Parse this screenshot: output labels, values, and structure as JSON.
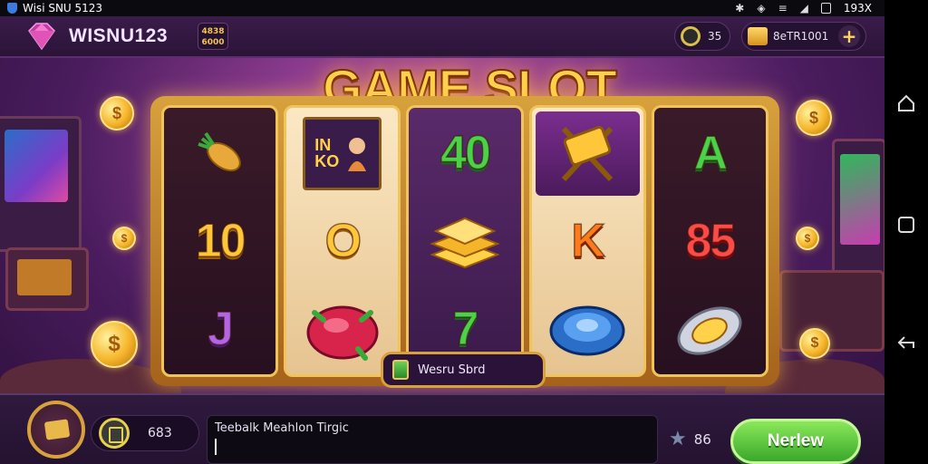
{
  "status_bar": {
    "app_label": "Wisi SNU 5123",
    "battery_text": "193X"
  },
  "header": {
    "player_name": "WISNU123",
    "level_badge_line1": "4838",
    "level_badge_line2": "6000",
    "timer_value": "35",
    "coins_value": "8eTR1001",
    "add_button_label": "+"
  },
  "game": {
    "title": "GAME SLOT",
    "reels": [
      [
        "carrot",
        "10",
        "J"
      ],
      [
        "IN KO treasure",
        "O",
        "red gem"
      ],
      [
        "40",
        "gold bars",
        "7"
      ],
      [
        "crossed hammer",
        "K",
        "blue gem"
      ],
      [
        "A",
        "85",
        "silver coin"
      ]
    ],
    "win_label": "Wesru Sbrd"
  },
  "bottom_bar": {
    "balance_text": "683",
    "message_text": "Teebalk Meahlon Tirgic",
    "lives_text": "86",
    "play_button_label": "Nerlew"
  },
  "colors": {
    "accent_gold": "#d7a13c",
    "play_green": "#3aa82a",
    "background_purple": "#4a1c5e"
  },
  "icons": {
    "status_shield": "shield-icon",
    "nav_back": "back-icon",
    "nav_home": "home-icon",
    "nav_recent": "recent-apps-icon"
  }
}
